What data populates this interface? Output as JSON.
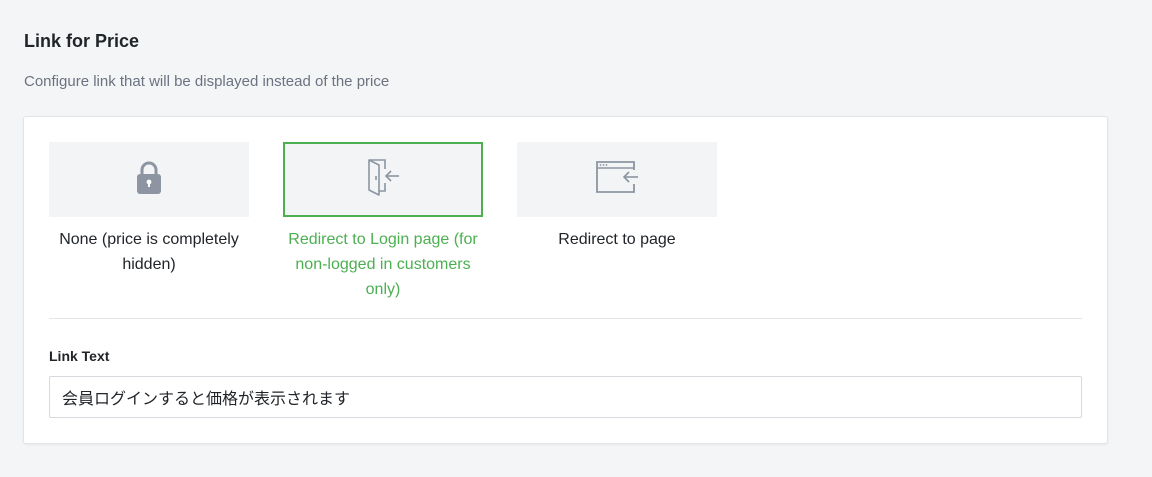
{
  "section": {
    "title": "Link for Price",
    "subtitle": "Configure link that will be displayed instead of the price"
  },
  "options": [
    {
      "label": "None (price is completely hidden)",
      "icon": "lock-icon",
      "selected": false
    },
    {
      "label": "Redirect to Login page (for non-logged in customers only)",
      "icon": "door-enter-icon",
      "selected": true
    },
    {
      "label": "Redirect to page",
      "icon": "browser-redirect-icon",
      "selected": false
    }
  ],
  "link_text": {
    "label": "Link Text",
    "value": "会員ログインすると価格が表示されます"
  },
  "colors": {
    "accent": "#4caf50",
    "icon": "#8c95a1",
    "tile_bg": "#f3f4f6"
  }
}
